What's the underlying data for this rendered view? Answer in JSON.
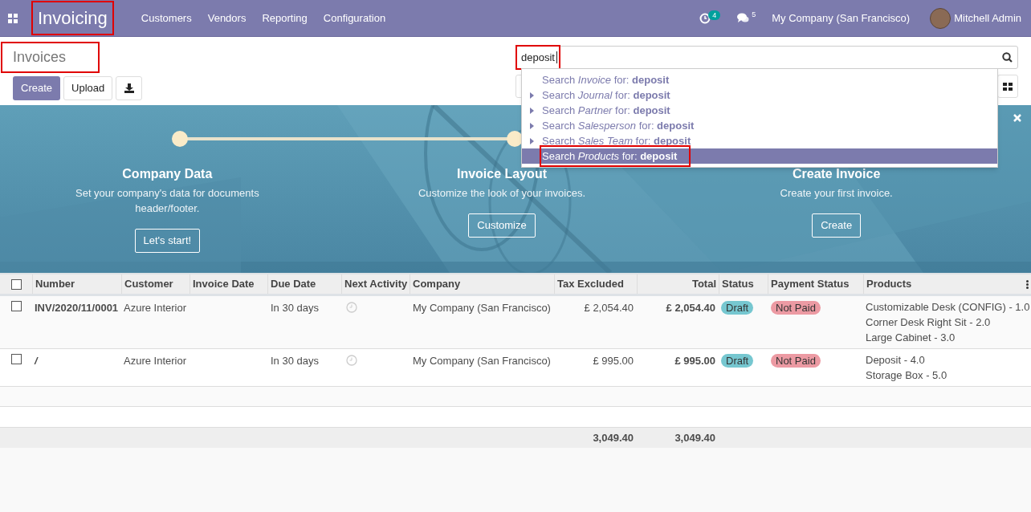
{
  "navbar": {
    "app_title": "Invoicing",
    "app_title_highlighted": true,
    "menu": [
      "Customers",
      "Vendors",
      "Reporting",
      "Configuration"
    ],
    "activity_count": "4",
    "message_count": "5",
    "company": "My Company (San Francisco)",
    "user": "Mitchell Admin"
  },
  "control_panel": {
    "title": "Invoices",
    "title_highlighted": true,
    "buttons": [
      {
        "kind": "primary",
        "label": "Create"
      },
      {
        "kind": "secondary",
        "label": "Upload"
      },
      {
        "kind": "download"
      }
    ]
  },
  "search": {
    "value": "deposit",
    "highlighted": true,
    "suggestions": [
      {
        "text": "Search *Invoice* for: **deposit**",
        "expandable": false,
        "selected": false,
        "highlighted": false
      },
      {
        "text": "Search *Journal* for: **deposit**",
        "expandable": true,
        "selected": false,
        "highlighted": false
      },
      {
        "text": "Search *Partner* for: **deposit**",
        "expandable": true,
        "selected": false,
        "highlighted": false
      },
      {
        "text": "Search *Salesperson* for: **deposit**",
        "expandable": true,
        "selected": false,
        "highlighted": false
      },
      {
        "text": "Search *Sales Team* for: **deposit**",
        "expandable": true,
        "selected": false,
        "highlighted": false
      },
      {
        "text": "Search *Products* for: **deposit**",
        "expandable": false,
        "selected": true,
        "highlighted": true
      }
    ]
  },
  "banner": {
    "steps": [
      {
        "title": "Company Data",
        "description": "Set your company's data for documents header/footer.",
        "button": "Let's start!"
      },
      {
        "title": "Invoice Layout",
        "description": "Customize the look of your invoices.",
        "button": "Customize"
      },
      {
        "title": "Create Invoice",
        "description": "Create your first invoice.",
        "button": "Create"
      }
    ]
  },
  "table": {
    "select_all_checked": false,
    "columns": [
      "Number",
      "Customer",
      "Invoice Date",
      "Due Date",
      "Next Activity",
      "Company",
      "Tax Excluded",
      "Total",
      "Status",
      "Payment Status",
      "Products"
    ],
    "rows": [
      {
        "checked": false,
        "number": "INV/2020/11/0001",
        "number_italic": false,
        "customer": "Azure Interior",
        "due_date": "In 30 days",
        "company": "My Company (San Francisco)",
        "tax_excluded": "£ 2,054.40",
        "total": "£ 2,054.40",
        "status": "Draft",
        "payment_status": "Not Paid",
        "products": [
          "Customizable Desk (CONFIG) - 1.0",
          "Corner Desk Right Sit - 2.0",
          "Large Cabinet - 3.0"
        ]
      },
      {
        "checked": false,
        "number": "/",
        "number_italic": true,
        "customer": "Azure Interior",
        "due_date": "In 30 days",
        "company": "My Company (San Francisco)",
        "tax_excluded": "£ 995.00",
        "total": "£ 995.00",
        "status": "Draft",
        "payment_status": "Not Paid",
        "products": [
          "Deposit - 4.0",
          "Storage Box - 5.0"
        ]
      }
    ],
    "totals": {
      "tax_excluded": "3,049.40",
      "total": "3,049.40"
    }
  }
}
